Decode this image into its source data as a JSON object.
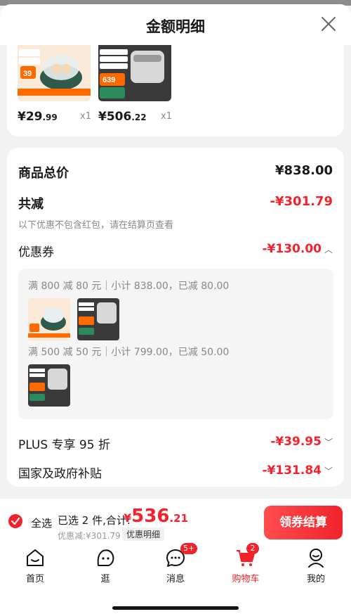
{
  "header": {
    "title": "金额明细"
  },
  "products": [
    {
      "price_main": "¥29",
      "price_dec": ".99",
      "qty": "x1",
      "thumb_tag": "39"
    },
    {
      "price_main": "¥506",
      "price_dec": ".22",
      "qty": "x1",
      "thumb_tag": "639"
    }
  ],
  "summary": {
    "total_label": "商品总价",
    "total_value": "¥838.00",
    "reduce_label": "共减",
    "reduce_value": "-¥301.79",
    "note": "以下优惠不包含红包，请在结算页查看",
    "coupon_label": "优惠券",
    "coupon_value": "-¥130.00",
    "coupon_rules": [
      {
        "text": "满 800 减 80 元｜小计 838.00，已减 80.00"
      },
      {
        "text": "满 500 减 50 元｜小计 799.00，已减 50.00"
      }
    ],
    "plus_label": "PLUS 专享 95 折",
    "plus_value": "-¥39.95",
    "subsidy_label": "国家及政府补贴",
    "subsidy_value": "-¥131.84"
  },
  "checkout": {
    "select_all": "全选",
    "selected_summary": "已选 2 件,合计:",
    "total_yen": "¥",
    "total_int": "536",
    "total_dec": ".21",
    "discount_line": "优惠减:¥301.79",
    "detail_tag": "优惠明细",
    "button": "领券结算"
  },
  "tabbar": {
    "tabs": [
      {
        "label": "首页",
        "icon": "home-icon"
      },
      {
        "label": "逛",
        "icon": "browse-icon"
      },
      {
        "label": "消息",
        "icon": "message-icon",
        "badge": "5+"
      },
      {
        "label": "购物车",
        "icon": "cart-icon",
        "badge": "2"
      },
      {
        "label": "我的",
        "icon": "profile-icon"
      }
    ]
  },
  "colors": {
    "accent": "#f5222d",
    "background": "#f2f2f2"
  }
}
